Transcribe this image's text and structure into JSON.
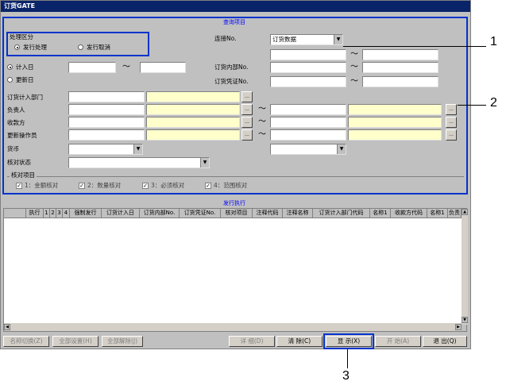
{
  "window": {
    "title": "订货GATE"
  },
  "search_section": {
    "title": "查询项目"
  },
  "process_group": {
    "label": "处理区分",
    "options": [
      "发行处理",
      "发行取消"
    ],
    "selected": 0
  },
  "connection": {
    "label": "连接No.",
    "value": "订货数据"
  },
  "date_radio": {
    "options": [
      "计入日",
      "更新日"
    ],
    "selected": 0
  },
  "tilde": "～",
  "order_no": {
    "label": "订货内部No."
  },
  "order_voucher": {
    "label": "订货凭证No."
  },
  "form_rows": [
    {
      "label": "订货计入部门"
    },
    {
      "label": "负责人"
    },
    {
      "label": "收款方"
    },
    {
      "label": "更新操作员"
    }
  ],
  "lookup_btn": "…",
  "currency": {
    "label": "货币"
  },
  "check_status": {
    "label": "核对状态"
  },
  "check_items": {
    "label": "核对项目",
    "items": [
      "1：金额核对",
      "2：数量核对",
      "3：必须核对",
      "4：范围核对"
    ]
  },
  "issue_section": {
    "title": "发行执行"
  },
  "grid": {
    "columns": [
      "执行",
      "1",
      "2",
      "3",
      "4",
      "强制发行",
      "订货计入日",
      "订货内部No.",
      "订货凭证No.",
      "核对项目",
      "注释代码",
      "注释名称",
      "订货计入部门代码",
      "名称1",
      "收款方代码",
      "名称1",
      "负责"
    ]
  },
  "buttons": {
    "name_switch": "名称切换(Z)",
    "select_all": "全部设置(H)",
    "clear_all": "全部解除(J)",
    "detail": "详 细(D)",
    "clear": "清 除(C)",
    "display": "显 示(X)",
    "start": "开 始(A)",
    "exit": "退 出(Q)"
  },
  "callouts": [
    "1",
    "2",
    "3"
  ]
}
